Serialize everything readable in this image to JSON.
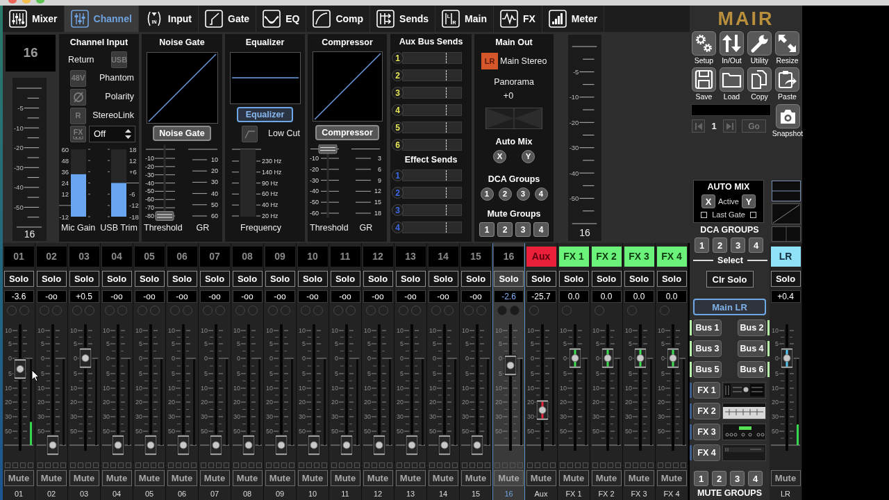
{
  "toolbar": {
    "tabs": [
      {
        "label": "Mixer",
        "selected": false
      },
      {
        "label": "Channel",
        "selected": true
      },
      {
        "label": "Input",
        "selected": false,
        "icon_text": [
          "IN"
        ]
      },
      {
        "label": "Gate",
        "selected": false
      },
      {
        "label": "EQ",
        "selected": false
      },
      {
        "label": "Comp",
        "selected": false
      },
      {
        "label": "Sends",
        "selected": false
      },
      {
        "label": "Main",
        "selected": false,
        "icon_text": [
          "L",
          "R"
        ]
      },
      {
        "label": "FX",
        "selected": false
      },
      {
        "label": "Meter",
        "selected": false
      }
    ]
  },
  "channel_panel": {
    "channel_number": "16",
    "left_meter": {
      "ticks": [
        "-5",
        "-10",
        "-20",
        "-30",
        "-40",
        "-50"
      ],
      "label": "16"
    },
    "channel_input": {
      "title": "Channel Input",
      "return_label": "Return",
      "usb_button": {
        "label": "USB",
        "on": false
      },
      "options": [
        {
          "kind": "text",
          "button": "48V",
          "label": "Phantom",
          "on": false
        },
        {
          "kind": "polarity",
          "label": "Polarity",
          "on": false
        },
        {
          "kind": "text",
          "button": "R",
          "label": "StereoLink",
          "on": false
        }
      ],
      "fx_button": {
        "label": "FX",
        "on": false
      },
      "fx_select": "Off",
      "gains": [
        {
          "label": "Mic Gain",
          "level": 0.63,
          "upper_ticks": [
            "60",
            "48",
            "36",
            "24",
            "12"
          ],
          "lower_ticks": [
            "-12"
          ]
        },
        {
          "label": "USB Trim",
          "level": 0.5,
          "upper_ticks": [
            "18",
            "12",
            "+6"
          ],
          "lower_ticks": [
            "-6",
            "-12",
            "-18"
          ]
        }
      ]
    },
    "noise_gate": {
      "title": "Noise Gate",
      "button": {
        "label": "Noise Gate",
        "on": false
      },
      "threshold": {
        "level": 0,
        "ticks": [
          "-10",
          "-20",
          "-30",
          "-40",
          "-50",
          "-60",
          "-70",
          "-80"
        ],
        "label": "Threshold"
      },
      "gr": {
        "ticks": [
          "10",
          "20",
          "30",
          "40",
          "50",
          "60"
        ],
        "label": "GR"
      }
    },
    "equalizer": {
      "title": "Equalizer",
      "button": {
        "label": "Equalizer",
        "on": true
      },
      "low_cut": {
        "label": "Low Cut",
        "on": false
      },
      "frequency": {
        "ticks": [
          "230 Hz",
          "140 Hz",
          "90 Hz",
          "60 Hz",
          "40 Hz",
          "20 Hz"
        ],
        "label": "Frequency"
      }
    },
    "compressor": {
      "title": "Compressor",
      "button": {
        "label": "Compressor",
        "on": false
      },
      "threshold": {
        "level": 1,
        "ticks": [
          "-10",
          "-20",
          "-30",
          "-40",
          "-50",
          "-60"
        ],
        "label": "Threshold"
      },
      "gr": {
        "ticks": [
          "3",
          "6",
          "9",
          "12",
          "15",
          "18"
        ],
        "label": "GR"
      }
    },
    "aux_sends": {
      "title": "Aux Bus Sends",
      "buses": [
        "1",
        "2",
        "3",
        "4",
        "5",
        "6"
      ],
      "effect_title": "Effect Sends",
      "effects": [
        "1",
        "2",
        "3",
        "4"
      ]
    },
    "main_out": {
      "title": "Main Out",
      "badge": "LR",
      "name": "Main Stereo",
      "panorama_label": "Panorama",
      "panorama_value": "+0",
      "auto_mix_title": "Auto Mix",
      "auto_mix_buttons": [
        "X",
        "Y"
      ],
      "dca_title": "DCA Groups",
      "dca_buttons": [
        "1",
        "2",
        "3",
        "4"
      ],
      "mute_title": "Mute Groups",
      "mute_buttons": [
        "1",
        "2",
        "3",
        "4"
      ]
    },
    "right_meter": {
      "ticks": [
        "-5",
        "-10",
        "-20",
        "-30",
        "-40",
        "-50"
      ],
      "label": "16"
    }
  },
  "strips": [
    {
      "kind": "input",
      "label": "01",
      "solo": "Solo",
      "value": "-3.6",
      "scale": [
        "10",
        "5",
        "0",
        "5",
        "10",
        "20",
        "30",
        "50"
      ],
      "fader": {
        "level": 0.63
      },
      "meter": {
        "level": 0.27
      },
      "mute": "Mute",
      "name": "01",
      "selected": false
    },
    {
      "kind": "input",
      "label": "02",
      "solo": "Solo",
      "value": "-oo",
      "scale": [
        "10",
        "5",
        "0",
        "5",
        "10",
        "20",
        "30",
        "50"
      ],
      "fader": {
        "level": 0
      },
      "mute": "Mute",
      "name": "02",
      "selected": false
    },
    {
      "kind": "input",
      "label": "03",
      "solo": "Solo",
      "value": "+0.5",
      "scale": [
        "10",
        "5",
        "0",
        "5",
        "10",
        "20",
        "30",
        "50"
      ],
      "fader": {
        "level": 0.72
      },
      "mute": "Mute",
      "name": "03",
      "selected": false
    },
    {
      "kind": "input",
      "label": "04",
      "solo": "Solo",
      "value": "-oo",
      "scale": [
        "10",
        "5",
        "0",
        "5",
        "10",
        "20",
        "30",
        "50"
      ],
      "fader": {
        "level": 0
      },
      "mute": "Mute",
      "name": "04",
      "selected": false
    },
    {
      "kind": "input",
      "label": "05",
      "solo": "Solo",
      "value": "-oo",
      "scale": [
        "10",
        "5",
        "0",
        "5",
        "10",
        "20",
        "30",
        "50"
      ],
      "fader": {
        "level": 0
      },
      "mute": "Mute",
      "name": "05",
      "selected": false
    },
    {
      "kind": "input",
      "label": "06",
      "solo": "Solo",
      "value": "-oo",
      "scale": [
        "10",
        "5",
        "0",
        "5",
        "10",
        "20",
        "30",
        "50"
      ],
      "fader": {
        "level": 0
      },
      "mute": "Mute",
      "name": "06",
      "selected": false
    },
    {
      "kind": "input",
      "label": "07",
      "solo": "Solo",
      "value": "-oo",
      "scale": [
        "10",
        "5",
        "0",
        "5",
        "10",
        "20",
        "30",
        "50"
      ],
      "fader": {
        "level": 0
      },
      "mute": "Mute",
      "name": "07",
      "selected": false
    },
    {
      "kind": "input",
      "label": "08",
      "solo": "Solo",
      "value": "-oo",
      "scale": [
        "10",
        "5",
        "0",
        "5",
        "10",
        "20",
        "30",
        "50"
      ],
      "fader": {
        "level": 0
      },
      "mute": "Mute",
      "name": "08",
      "selected": false
    },
    {
      "kind": "input",
      "label": "09",
      "solo": "Solo",
      "value": "-oo",
      "scale": [
        "10",
        "5",
        "0",
        "5",
        "10",
        "20",
        "30",
        "50"
      ],
      "fader": {
        "level": 0
      },
      "mute": "Mute",
      "name": "09",
      "selected": false
    },
    {
      "kind": "input",
      "label": "10",
      "solo": "Solo",
      "value": "-oo",
      "scale": [
        "10",
        "5",
        "0",
        "5",
        "10",
        "20",
        "30",
        "50"
      ],
      "fader": {
        "level": 0
      },
      "mute": "Mute",
      "name": "10",
      "selected": false
    },
    {
      "kind": "input",
      "label": "11",
      "solo": "Solo",
      "value": "-oo",
      "scale": [
        "10",
        "5",
        "0",
        "5",
        "10",
        "20",
        "30",
        "50"
      ],
      "fader": {
        "level": 0
      },
      "mute": "Mute",
      "name": "11",
      "selected": false
    },
    {
      "kind": "input",
      "label": "12",
      "solo": "Solo",
      "value": "-oo",
      "scale": [
        "10",
        "5",
        "0",
        "5",
        "10",
        "20",
        "30",
        "50"
      ],
      "fader": {
        "level": 0
      },
      "mute": "Mute",
      "name": "12",
      "selected": false
    },
    {
      "kind": "input",
      "label": "13",
      "solo": "Solo",
      "value": "-oo",
      "scale": [
        "10",
        "5",
        "0",
        "5",
        "10",
        "20",
        "30",
        "50"
      ],
      "fader": {
        "level": 0
      },
      "mute": "Mute",
      "name": "13",
      "selected": false
    },
    {
      "kind": "input",
      "label": "14",
      "solo": "Solo",
      "value": "-oo",
      "scale": [
        "10",
        "5",
        "0",
        "5",
        "10",
        "20",
        "30",
        "50"
      ],
      "fader": {
        "level": 0
      },
      "mute": "Mute",
      "name": "14",
      "selected": false
    },
    {
      "kind": "input",
      "label": "15",
      "solo": "Solo",
      "value": "-oo",
      "scale": [
        "10",
        "5",
        "0",
        "5",
        "10",
        "20",
        "30",
        "50"
      ],
      "fader": {
        "level": 0
      },
      "mute": "Mute",
      "name": "15",
      "selected": false
    },
    {
      "kind": "input",
      "label": "16",
      "solo": "Solo",
      "value": "-2.6",
      "scale": [
        "10",
        "5",
        "0",
        "5",
        "10",
        "20",
        "30",
        "50"
      ],
      "fader": {
        "level": 0.66
      },
      "mute": "Mute",
      "name": "16",
      "selected": true
    },
    {
      "kind": "aux",
      "label": "Aux",
      "solo": "Solo",
      "value": "-25.7",
      "scale": [
        "10",
        "5",
        "0",
        "5",
        "10",
        "20",
        "30",
        "50"
      ],
      "fader": {
        "level": 0.29
      },
      "mute": "Mute",
      "name": "Aux",
      "selected": false
    },
    {
      "kind": "fx",
      "label": "FX 1",
      "solo": "Solo",
      "value": "0.0",
      "scale": [
        "10",
        "5",
        "0",
        "5",
        "10",
        "20",
        "30",
        "50"
      ],
      "fader": {
        "level": 0.72
      },
      "mute": "Mute",
      "name": "FX 1",
      "selected": false
    },
    {
      "kind": "fx",
      "label": "FX 2",
      "solo": "Solo",
      "value": "0.0",
      "scale": [
        "10",
        "5",
        "0",
        "5",
        "10",
        "20",
        "30",
        "50"
      ],
      "fader": {
        "level": 0.72
      },
      "mute": "Mute",
      "name": "FX 2",
      "selected": false
    },
    {
      "kind": "fx",
      "label": "FX 3",
      "solo": "Solo",
      "value": "0.0",
      "scale": [
        "10",
        "5",
        "0",
        "5",
        "10",
        "20",
        "30",
        "50"
      ],
      "fader": {
        "level": 0.72
      },
      "mute": "Mute",
      "name": "FX 3",
      "selected": false
    },
    {
      "kind": "fx",
      "label": "FX 4",
      "solo": "Solo",
      "value": "0.0",
      "scale": [
        "10",
        "5",
        "0",
        "5",
        "10",
        "20",
        "30",
        "50"
      ],
      "fader": {
        "level": 0.72
      },
      "mute": "Mute",
      "name": "FX 4",
      "selected": false
    }
  ],
  "side_panel": {
    "logo": "MAIR",
    "tools": [
      "Setup",
      "In/Out",
      "Utility",
      "Resize",
      "Save",
      "Load",
      "Copy",
      "Paste"
    ],
    "snapshot": {
      "index": "1",
      "go": "Go",
      "label": "Snapshot"
    },
    "auto_mix": {
      "title": "AUTO MIX",
      "buttons": [
        "X",
        "Y"
      ],
      "active": "Active",
      "last_gate": "Last Gate",
      "checkboxes": [
        {
          "checked": false
        },
        {
          "checked": false
        }
      ]
    },
    "dca": {
      "title": "DCA GROUPS",
      "buttons": [
        "1",
        "2",
        "3",
        "4"
      ]
    },
    "select": "Select",
    "clear_solo": "Clr Solo",
    "main_lr": {
      "label": "Main LR",
      "selected": true
    },
    "buses": [
      {
        "label": "Bus 1",
        "selected": false
      },
      {
        "label": "Bus 2",
        "selected": false
      },
      {
        "label": "Bus 3",
        "selected": false
      },
      {
        "label": "Bus 4",
        "selected": false
      },
      {
        "label": "Bus 5",
        "selected": false
      },
      {
        "label": "Bus 6",
        "selected": false
      }
    ],
    "effects": [
      {
        "label": "FX 1",
        "selected": false
      },
      {
        "label": "FX 2",
        "selected": false
      },
      {
        "label": "FX 3",
        "selected": false
      },
      {
        "label": "FX 4",
        "selected": false
      }
    ],
    "mute_groups": {
      "buttons": [
        "1",
        "2",
        "3",
        "4"
      ],
      "title": "MUTE GROUPS"
    }
  },
  "main_strip": {
    "kind": "main",
    "label": "LR",
    "solo": "Solo",
    "value": "+0.4",
    "scale": [
      "10",
      "5",
      "0",
      "5",
      "10",
      "20",
      "30",
      "50"
    ],
    "fader": {
      "level": 0.72
    },
    "meter": {
      "level": 0.24
    },
    "mute": "Mute",
    "name": "LR"
  }
}
